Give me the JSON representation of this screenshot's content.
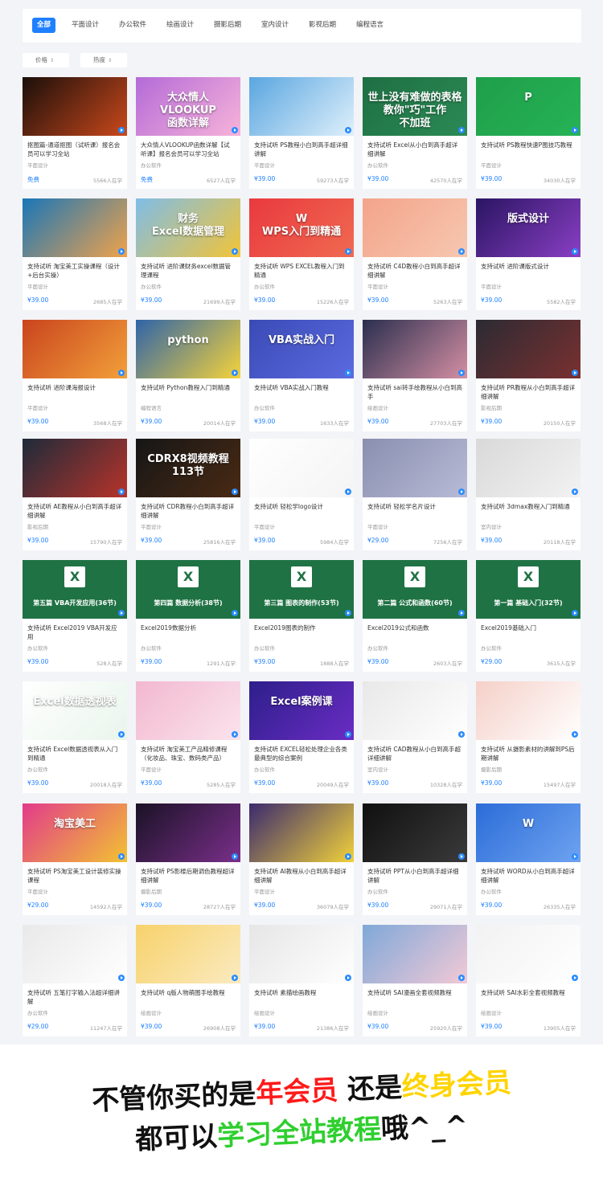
{
  "nav": {
    "items": [
      {
        "label": "全部",
        "active": true
      },
      {
        "label": "平面设计"
      },
      {
        "label": "办公软件"
      },
      {
        "label": "绘画设计"
      },
      {
        "label": "摄影后期"
      },
      {
        "label": "室内设计"
      },
      {
        "label": "影视后期"
      },
      {
        "label": "编程语言"
      }
    ]
  },
  "filters": [
    {
      "label": "价格"
    },
    {
      "label": "热度"
    }
  ],
  "courses": [
    {
      "title": "抠图篇-通道抠图（试听课）报名会员可以学习全站",
      "category": "平面设计",
      "price": "免费",
      "learners": "5566人在学",
      "thumb_color": "#1a0f0a",
      "thumb_color2": "#c9481c",
      "thumb_text": ""
    },
    {
      "title": "大众情人VLOOKUP函数详解【试听课】报名会员可以学习全站",
      "category": "办公软件",
      "price": "免费",
      "learners": "6527人在学",
      "thumb_color": "#b46bd8",
      "thumb_color2": "#f7b3d9",
      "thumb_text": "大众情人\nVLOOKUP\n函数详解"
    },
    {
      "title": "支持试听 PS教程小白到高手超详细讲解",
      "category": "平面设计",
      "price": "¥39.00",
      "learners": "59273人在学",
      "thumb_color": "#5aa6e0",
      "thumb_color2": "#dff0fb",
      "thumb_text": ""
    },
    {
      "title": "支持试听 Excel从小白到高手超详细讲解",
      "category": "办公软件",
      "price": "¥39.00",
      "learners": "42570人在学",
      "thumb_color": "#1e6f43",
      "thumb_color2": "#2b8a55",
      "thumb_text": "世上没有难做的表格\n教你\"巧\"工作\n不加班"
    },
    {
      "title": "支持试听 PS教程快速P图技巧教程",
      "category": "平面设计",
      "price": "¥39.00",
      "learners": "34030人在学",
      "thumb_color": "#1f9e4a",
      "thumb_color2": "#26b356",
      "thumb_text": "P"
    },
    {
      "title": "支持试听 淘宝美工实操课程（设计+后台实操）",
      "category": "平面设计",
      "price": "¥39.00",
      "learners": "2685人在学",
      "thumb_color": "#1976b8",
      "thumb_color2": "#f0a24a",
      "thumb_text": ""
    },
    {
      "title": "支持试听 进阶课财务excel数据管理课程",
      "category": "办公软件",
      "price": "¥39.00",
      "learners": "21699人在学",
      "thumb_color": "#7fbde8",
      "thumb_color2": "#f2c437",
      "thumb_text": "财务\nExcel数据管理"
    },
    {
      "title": "支持试听 WPS EXCEL教程入门到精通",
      "category": "办公软件",
      "price": "¥39.00",
      "learners": "15226人在学",
      "thumb_color": "#e9393f",
      "thumb_color2": "#f06a50",
      "thumb_text": "W\nWPS入门到精通"
    },
    {
      "title": "支持试听 C4D教程小白到高手超详细讲解",
      "category": "平面设计",
      "price": "¥39.00",
      "learners": "5263人在学",
      "thumb_color": "#f3a48a",
      "thumb_color2": "#f7c7b0",
      "thumb_text": ""
    },
    {
      "title": "支持试听 进阶课版式设计",
      "category": "平面设计",
      "price": "¥39.00",
      "learners": "5582人在学",
      "thumb_color": "#2a1563",
      "thumb_color2": "#8a3fc4",
      "thumb_text": "版式设计"
    },
    {
      "title": "支持试听 进阶课海报设计",
      "category": "平面设计",
      "price": "¥39.00",
      "learners": "3568人在学",
      "thumb_color": "#c9441e",
      "thumb_color2": "#f2a03a",
      "thumb_text": ""
    },
    {
      "title": "支持试听 Python教程入门到精通",
      "category": "编程语言",
      "price": "¥39.00",
      "learners": "20014人在学",
      "thumb_color": "#2f64a8",
      "thumb_color2": "#f5d33a",
      "thumb_text": "python"
    },
    {
      "title": "支持试听 VBA实战入门教程",
      "category": "办公软件",
      "price": "¥39.00",
      "learners": "1633人在学",
      "thumb_color": "#3a4ab5",
      "thumb_color2": "#5b6be0",
      "thumb_text": "VBA实战入门"
    },
    {
      "title": "支持试听 sai转手绘教程从小白到高手",
      "category": "绘画设计",
      "price": "¥39.00",
      "learners": "27703人在学",
      "thumb_color": "#2a2f4f",
      "thumb_color2": "#d48fa3",
      "thumb_text": ""
    },
    {
      "title": "支持试听 PR教程从小白到高手超详细讲解",
      "category": "影视后期",
      "price": "¥39.00",
      "learners": "20150人在学",
      "thumb_color": "#2b2b33",
      "thumb_color2": "#7a3030",
      "thumb_text": ""
    },
    {
      "title": "支持试听 AE教程从小白到高手超详细讲解",
      "category": "影视后期",
      "price": "¥39.00",
      "learners": "15790人在学",
      "thumb_color": "#1d2b3a",
      "thumb_color2": "#b8332a",
      "thumb_text": ""
    },
    {
      "title": "支持试听 CDR教程小白到高手超详细讲解",
      "category": "平面设计",
      "price": "¥39.00",
      "learners": "25816人在学",
      "thumb_color": "#161616",
      "thumb_color2": "#4a2a14",
      "thumb_text": "CDRX8视频教程113节"
    },
    {
      "title": "支持试听 轻松学logo设计",
      "category": "平面设计",
      "price": "¥39.00",
      "learners": "5984人在学",
      "thumb_color": "#ffffff",
      "thumb_color2": "#f4f4f4",
      "thumb_text": ""
    },
    {
      "title": "支持试听 轻松学名片设计",
      "category": "平面设计",
      "price": "¥29.00",
      "learners": "7256人在学",
      "thumb_color": "#8a8fb0",
      "thumb_color2": "#b7bbd6",
      "thumb_text": ""
    },
    {
      "title": "支持试听 3dmax教程入门到精通",
      "category": "室内设计",
      "price": "¥39.00",
      "learners": "20118人在学",
      "thumb_color": "#d9d9d9",
      "thumb_color2": "#f2f2f2",
      "thumb_text": ""
    },
    {
      "title": "支持试听 Excel2019 VBA开发应用",
      "category": "办公软件",
      "price": "¥39.00",
      "learners": "528人在学",
      "thumb_color": "#1f7244",
      "thumb_color2": "#1f7244",
      "thumb_text": "",
      "excel_caption": "第五篇 VBA开发应用(36节)"
    },
    {
      "title": "Excel2019数据分析",
      "category": "办公软件",
      "price": "¥39.00",
      "learners": "1291人在学",
      "thumb_color": "#1f7244",
      "thumb_color2": "#1f7244",
      "thumb_text": "",
      "excel_caption": "第四篇 数据分析(38节)"
    },
    {
      "title": "Excel2019图表的制作",
      "category": "办公软件",
      "price": "¥39.00",
      "learners": "1888人在学",
      "thumb_color": "#1f7244",
      "thumb_color2": "#1f7244",
      "thumb_text": "",
      "excel_caption": "第三篇 图表的制作(53节)"
    },
    {
      "title": "Excel2019公式和函数",
      "category": "办公软件",
      "price": "¥39.00",
      "learners": "2603人在学",
      "thumb_color": "#1f7244",
      "thumb_color2": "#1f7244",
      "thumb_text": "",
      "excel_caption": "第二篇 公式和函数(60节)"
    },
    {
      "title": "Excel2019基础入门",
      "category": "办公软件",
      "price": "¥29.00",
      "learners": "3615人在学",
      "thumb_color": "#1f7244",
      "thumb_color2": "#1f7244",
      "thumb_text": "",
      "excel_caption": "第一篇 基础入门(32节)"
    },
    {
      "title": "支持试听 Excel数据透视表从入门到精通",
      "category": "办公软件",
      "price": "¥39.00",
      "learners": "20018人在学",
      "thumb_color": "#ffffff",
      "thumb_color2": "#e9f5ec",
      "thumb_text": "Excel数据透视表"
    },
    {
      "title": "支持试听 淘宝美工产品精修课程（化妆品、珠宝、数码类产品）",
      "category": "平面设计",
      "price": "¥39.00",
      "learners": "5285人在学",
      "thumb_color": "#f2b8cf",
      "thumb_color2": "#fbe3ec",
      "thumb_text": ""
    },
    {
      "title": "支持试听 EXCEL轻松处理企业各类最典型的综合案例",
      "category": "办公软件",
      "price": "¥39.00",
      "learners": "20049人在学",
      "thumb_color": "#2d1f8a",
      "thumb_color2": "#6a2cc4",
      "thumb_text": "Excel案例课"
    },
    {
      "title": "支持试听 CAD教程从小白到高手超详细讲解",
      "category": "室内设计",
      "price": "¥39.00",
      "learners": "10328人在学",
      "thumb_color": "#e8e8e8",
      "thumb_color2": "#ffffff",
      "thumb_text": ""
    },
    {
      "title": "支持试听 从摄影素材的讲解到PS后期讲解",
      "category": "摄影后期",
      "price": "¥39.00",
      "learners": "15497人在学",
      "thumb_color": "#f5d0c8",
      "thumb_color2": "#ffffff",
      "thumb_text": ""
    },
    {
      "title": "支持试听 PS淘宝美工设计装修实操课程",
      "category": "平面设计",
      "price": "¥29.00",
      "learners": "14592人在学",
      "thumb_color": "#e23b8a",
      "thumb_color2": "#f2c232",
      "thumb_text": "淘宝美工"
    },
    {
      "title": "支持试听 PS影楼后期调色教程超详细讲解",
      "category": "摄影后期",
      "price": "¥39.00",
      "learners": "28727人在学",
      "thumb_color": "#1a1226",
      "thumb_color2": "#7a2f8a",
      "thumb_text": ""
    },
    {
      "title": "支持试听 AI教程从小白到高手超详细讲解",
      "category": "平面设计",
      "price": "¥39.00",
      "learners": "36079人在学",
      "thumb_color": "#3b2a6e",
      "thumb_color2": "#f1d13a",
      "thumb_text": ""
    },
    {
      "title": "支持试听 PPT从小白到高手超详细讲解",
      "category": "办公软件",
      "price": "¥39.00",
      "learners": "29071人在学",
      "thumb_color": "#101010",
      "thumb_color2": "#3a3a3a",
      "thumb_text": ""
    },
    {
      "title": "支持试听 WORD从小白到高手超详细讲解",
      "category": "办公软件",
      "price": "¥39.00",
      "learners": "26335人在学",
      "thumb_color": "#2b6cd8",
      "thumb_color2": "#6ea3f0",
      "thumb_text": "W"
    },
    {
      "title": "支持试听 五笔打字输入法超详细讲解",
      "category": "办公软件",
      "price": "¥29.00",
      "learners": "11247人在学",
      "thumb_color": "#e9e9e9",
      "thumb_color2": "#ffffff",
      "thumb_text": ""
    },
    {
      "title": "支持试听 q版人物萌图手绘教程",
      "category": "绘画设计",
      "price": "¥39.00",
      "learners": "26908人在学",
      "thumb_color": "#f7d26b",
      "thumb_color2": "#fbeac0",
      "thumb_text": ""
    },
    {
      "title": "支持试听 素描绘画教程",
      "category": "绘画设计",
      "price": "¥39.00",
      "learners": "21386人在学",
      "thumb_color": "#e6e6e6",
      "thumb_color2": "#ffffff",
      "thumb_text": ""
    },
    {
      "title": "支持试听 SAI漫画全套视频教程",
      "category": "绘画设计",
      "price": "¥39.00",
      "learners": "25920人在学",
      "thumb_color": "#7fa8d8",
      "thumb_color2": "#f2c9d6",
      "thumb_text": ""
    },
    {
      "title": "支持试听 SAI水彩全套视频教程",
      "category": "绘画设计",
      "price": "¥39.00",
      "learners": "13905人在学",
      "thumb_color": "#f2f2f2",
      "thumb_color2": "#ffffff",
      "thumb_text": ""
    }
  ],
  "slogan": {
    "line1_a": "不管你买的是",
    "line1_b": "年会员",
    "line1_c": " 还是",
    "line1_d": "终身会员",
    "line2_a": "都可以",
    "line2_b": "学习全站教程",
    "line2_c": "哦^_^"
  }
}
